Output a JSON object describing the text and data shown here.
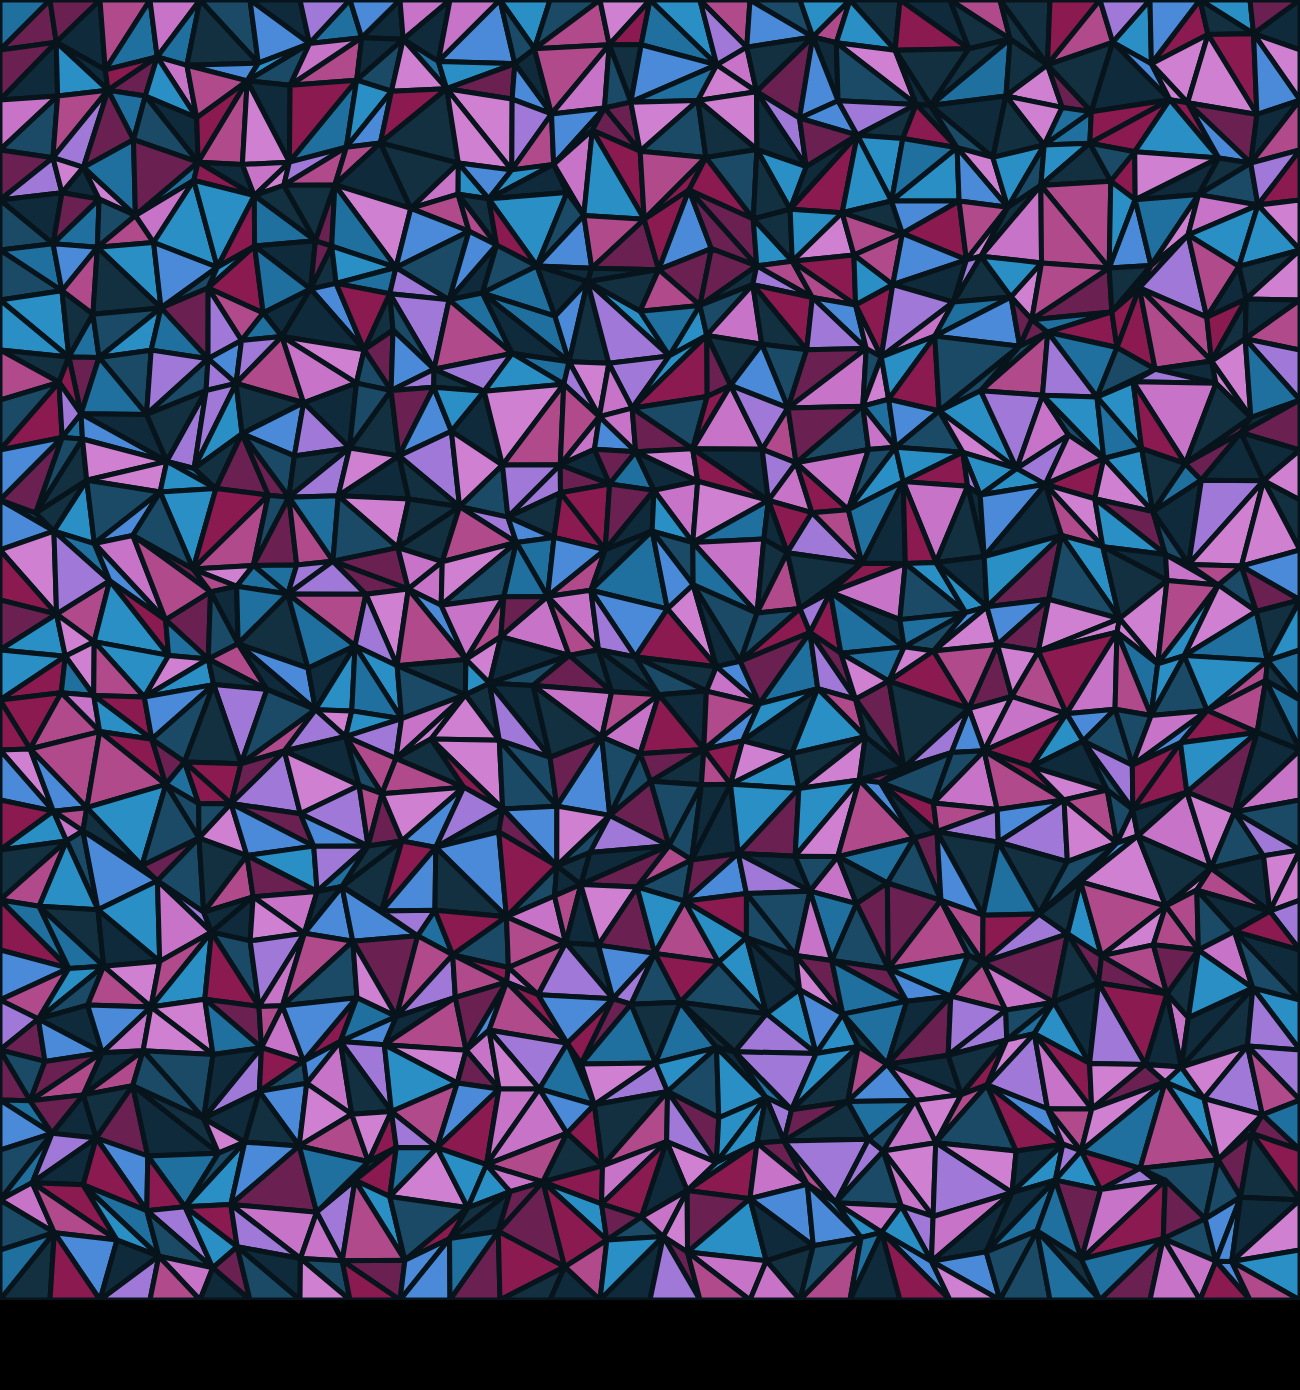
{
  "artwork": {
    "kind": "mosaic"
  }
}
